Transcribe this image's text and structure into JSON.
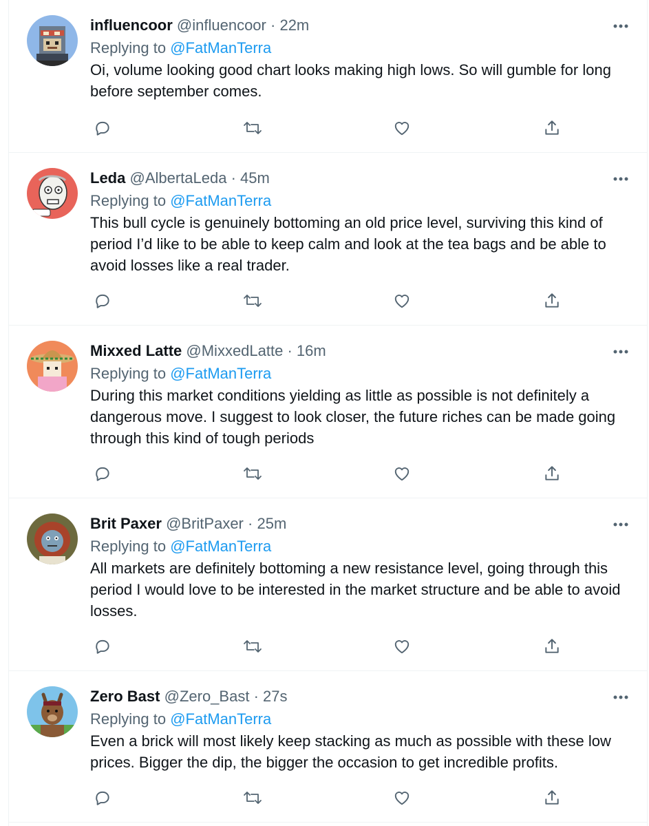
{
  "reply_label": "Replying to",
  "tweets": [
    {
      "name": "influencoor",
      "handle": "@influencoor",
      "dot": "·",
      "time": "22m",
      "replying_to": "@FatManTerra",
      "text": "Oi, volume looking good chart looks making high lows. So will gumble for long before september comes.",
      "avatar": {
        "bg": "#8fb7e8",
        "icon": "pixel-helmet-avatar"
      }
    },
    {
      "name": "Leda",
      "handle": "@AlbertaLeda",
      "dot": "·",
      "time": "45m",
      "replying_to": "@FatManTerra",
      "text": "This bull cycle is genuinely bottoming an old price level, surviving this kind of period I’d like to be able to keep calm and look at the tea bags and be able to avoid losses like a real trader.",
      "avatar": {
        "bg": "#e8645a",
        "icon": "cartoon-old-man-avatar"
      }
    },
    {
      "name": "Mixxed Latte",
      "handle": "@MixxedLatte",
      "dot": "·",
      "time": "16m",
      "replying_to": "@FatManTerra",
      "text": "During this market conditions yielding as little as possible is not definitely a dangerous move. I suggest to look closer, the future riches can be made going through this kind of tough periods",
      "avatar": {
        "bg": "#f08a5a",
        "icon": "sombrero-character-avatar"
      }
    },
    {
      "name": "Brit Paxer",
      "handle": "@BritPaxer",
      "dot": "·",
      "time": "25m",
      "replying_to": "@FatManTerra",
      "text": "All markets are definitely bottoming a new resistance level, going through this period I would love to be interested in the market structure and be able to avoid losses.",
      "avatar": {
        "bg": "#6d6a3e",
        "icon": "lion-character-avatar"
      }
    },
    {
      "name": "Zero Bast",
      "handle": "@Zero_Bast",
      "dot": "·",
      "time": "27s",
      "replying_to": "@FatManTerra",
      "text": "Even a brick will most likely keep stacking as much as possible with these low prices. Bigger the dip, the bigger the occasion to get incredible profits.",
      "avatar": {
        "bg": "#7ec3ea",
        "icon": "llama-character-avatar"
      }
    }
  ],
  "colors": {
    "text": "#0f1419",
    "secondary": "#536471",
    "link": "#1d9bf0",
    "border": "#eff3f4"
  },
  "icons": [
    "more-icon",
    "reply-icon",
    "retweet-icon",
    "like-icon",
    "share-icon"
  ]
}
